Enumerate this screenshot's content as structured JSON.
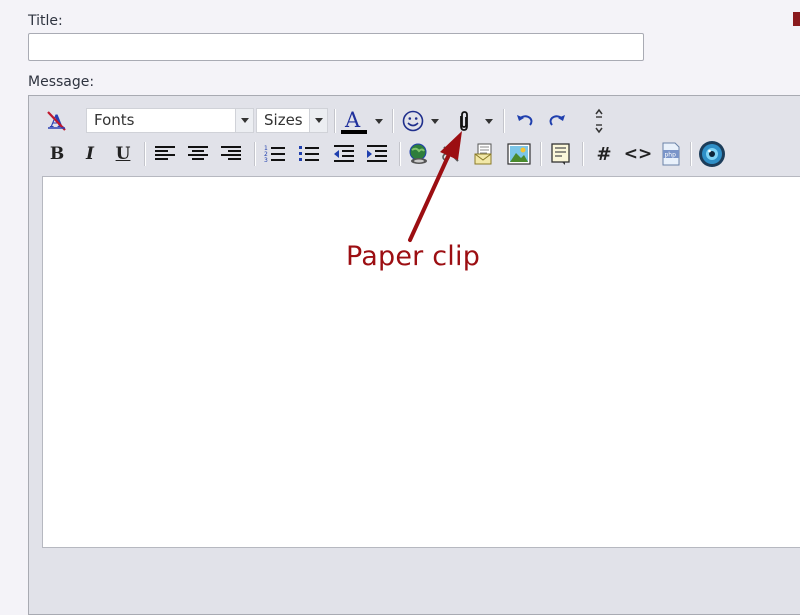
{
  "form": {
    "title_label": "Title:",
    "title_value": "",
    "message_label": "Message:",
    "message_value": ""
  },
  "toolbar": {
    "font_select": {
      "label": "Fonts"
    },
    "size_select": {
      "label": "Sizes"
    },
    "bold_label": "B",
    "italic_label": "I",
    "underline_label": "U",
    "wrap_code_label": "#",
    "wrap_html_label": "<>",
    "php_icon_label": "php",
    "text_color_label": "A",
    "text_color_underline": "#000000",
    "row1_icons": [
      "remove-format-icon",
      "text-color-icon",
      "smiley-icon",
      "paper-clip-icon",
      "undo-icon",
      "redo-icon",
      "resize-icon"
    ],
    "row2_icons": [
      "bold-icon",
      "italic-icon",
      "underline-icon",
      "align-left-icon",
      "align-center-icon",
      "align-right-icon",
      "ordered-list-icon",
      "unordered-list-icon",
      "outdent-icon",
      "indent-icon",
      "insert-link-icon",
      "unlink-icon",
      "insert-email-icon",
      "insert-image-icon",
      "quote-icon",
      "code-hash-icon",
      "html-code-icon",
      "php-icon",
      "preview-icon"
    ]
  },
  "annotation": {
    "label": "Paper clip",
    "color": "#9c0e12"
  },
  "colors": {
    "page_bg": "#f4f3f8",
    "editor_bg": "#ffffff",
    "toolbar_bg": "#e1e2e9",
    "icon_blue": "#1f3fae"
  }
}
